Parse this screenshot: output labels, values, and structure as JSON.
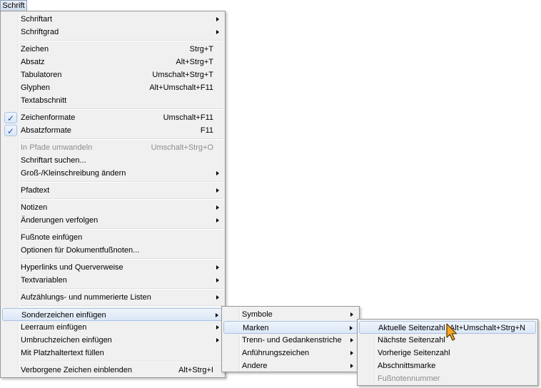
{
  "menubar": {
    "title": "Schrift"
  },
  "main_menu": {
    "groups": [
      [
        {
          "label": "Schriftart",
          "shortcut": "",
          "submenu": true
        },
        {
          "label": "Schriftgrad",
          "shortcut": "",
          "submenu": true
        }
      ],
      [
        {
          "label": "Zeichen",
          "shortcut": "Strg+T"
        },
        {
          "label": "Absatz",
          "shortcut": "Alt+Strg+T"
        },
        {
          "label": "Tabulatoren",
          "shortcut": "Umschalt+Strg+T"
        },
        {
          "label": "Glyphen",
          "shortcut": "Alt+Umschalt+F11"
        },
        {
          "label": "Textabschnitt",
          "shortcut": ""
        }
      ],
      [
        {
          "label": "Zeichenformate",
          "shortcut": "Umschalt+F11",
          "checked": true
        },
        {
          "label": "Absatzformate",
          "shortcut": "F11",
          "checked": true
        }
      ],
      [
        {
          "label": "In Pfade umwandeln",
          "shortcut": "Umschalt+Strg+O",
          "disabled": true
        },
        {
          "label": "Schriftart suchen...",
          "shortcut": ""
        },
        {
          "label": "Groß-/Kleinschreibung ändern",
          "shortcut": "",
          "submenu": true
        }
      ],
      [
        {
          "label": "Pfadtext",
          "shortcut": "",
          "submenu": true
        }
      ],
      [
        {
          "label": "Notizen",
          "shortcut": "",
          "submenu": true
        },
        {
          "label": "Änderungen verfolgen",
          "shortcut": "",
          "submenu": true
        }
      ],
      [
        {
          "label": "Fußnote einfügen",
          "shortcut": ""
        },
        {
          "label": "Optionen für Dokumentfußnoten...",
          "shortcut": ""
        }
      ],
      [
        {
          "label": "Hyperlinks und Querverweise",
          "shortcut": "",
          "submenu": true
        },
        {
          "label": "Textvariablen",
          "shortcut": "",
          "submenu": true
        }
      ],
      [
        {
          "label": "Aufzählungs- und nummerierte Listen",
          "shortcut": "",
          "submenu": true
        }
      ],
      [
        {
          "label": "Sonderzeichen einfügen",
          "shortcut": "",
          "submenu": true,
          "highlighted": true
        },
        {
          "label": "Leerraum einfügen",
          "shortcut": "",
          "submenu": true
        },
        {
          "label": "Umbruchzeichen einfügen",
          "shortcut": "",
          "submenu": true
        },
        {
          "label": "Mit Platzhaltertext füllen",
          "shortcut": ""
        }
      ],
      [
        {
          "label": "Verborgene Zeichen einblenden",
          "shortcut": "Alt+Strg+I"
        }
      ]
    ]
  },
  "sonderzeichen_menu": {
    "items": [
      {
        "label": "Symbole",
        "submenu": true
      },
      {
        "label": "Marken",
        "submenu": true,
        "highlighted": true
      },
      {
        "label": "Trenn- und Gedankenstriche",
        "submenu": true
      },
      {
        "label": "Anführungszeichen",
        "submenu": true
      },
      {
        "label": "Andere",
        "submenu": true
      }
    ]
  },
  "marken_menu": {
    "items": [
      {
        "label": "Aktuelle Seitenzahl",
        "shortcut": "Alt+Umschalt+Strg+N",
        "highlighted": true
      },
      {
        "label": "Nächste Seitenzahl",
        "shortcut": ""
      },
      {
        "label": "Vorherige Seitenzahl",
        "shortcut": ""
      },
      {
        "label": "Abschnittsmarke",
        "shortcut": ""
      },
      {
        "label": "Fußnotennummer",
        "shortcut": "",
        "disabled": true
      }
    ]
  },
  "colors": {
    "highlight_border": "#a9c3e6",
    "check": "#1d4fbd",
    "cursor_fill": "#f5a623",
    "menu_bg": "#f0f0f0"
  },
  "icons": {
    "check": "checkmark-icon",
    "cursor": "mouse-pointer-icon"
  }
}
